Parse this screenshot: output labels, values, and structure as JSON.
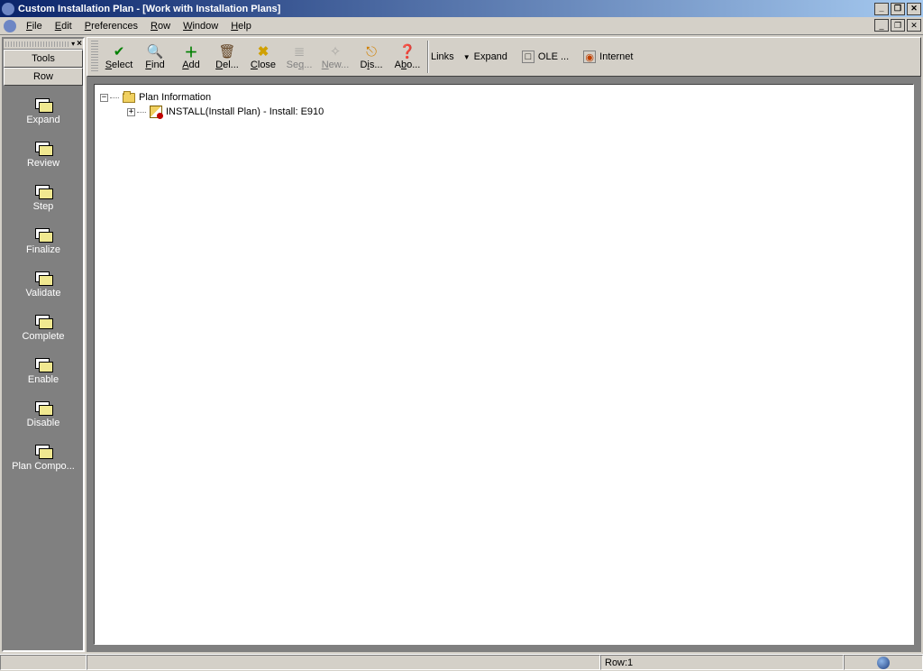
{
  "window": {
    "title": "Custom Installation Plan - [Work with Installation Plans]"
  },
  "menu": {
    "file": "File",
    "edit": "Edit",
    "preferences": "Preferences",
    "row": "Row",
    "window": "Window",
    "help": "Help"
  },
  "sidebar": {
    "tab_tools": "Tools",
    "tab_row": "Row",
    "actions": [
      {
        "label": "Expand"
      },
      {
        "label": "Review"
      },
      {
        "label": "Step"
      },
      {
        "label": "Finalize"
      },
      {
        "label": "Validate"
      },
      {
        "label": "Complete"
      },
      {
        "label": "Enable"
      },
      {
        "label": "Disable"
      },
      {
        "label": "Plan Compo..."
      }
    ]
  },
  "toolbar": {
    "select": "Select",
    "find": "Find",
    "add": "Add",
    "del": "Del...",
    "close": "Close",
    "seq": "Seq...",
    "new": "New...",
    "dis": "Dis...",
    "abo": "Abo...",
    "links": "Links",
    "expand": "Expand",
    "ole": "OLE ...",
    "internet": "Internet"
  },
  "tree": {
    "root": "Plan Information",
    "child1": "INSTALL(Install Plan) - Install: E910"
  },
  "statusbar": {
    "row": "Row:1"
  }
}
